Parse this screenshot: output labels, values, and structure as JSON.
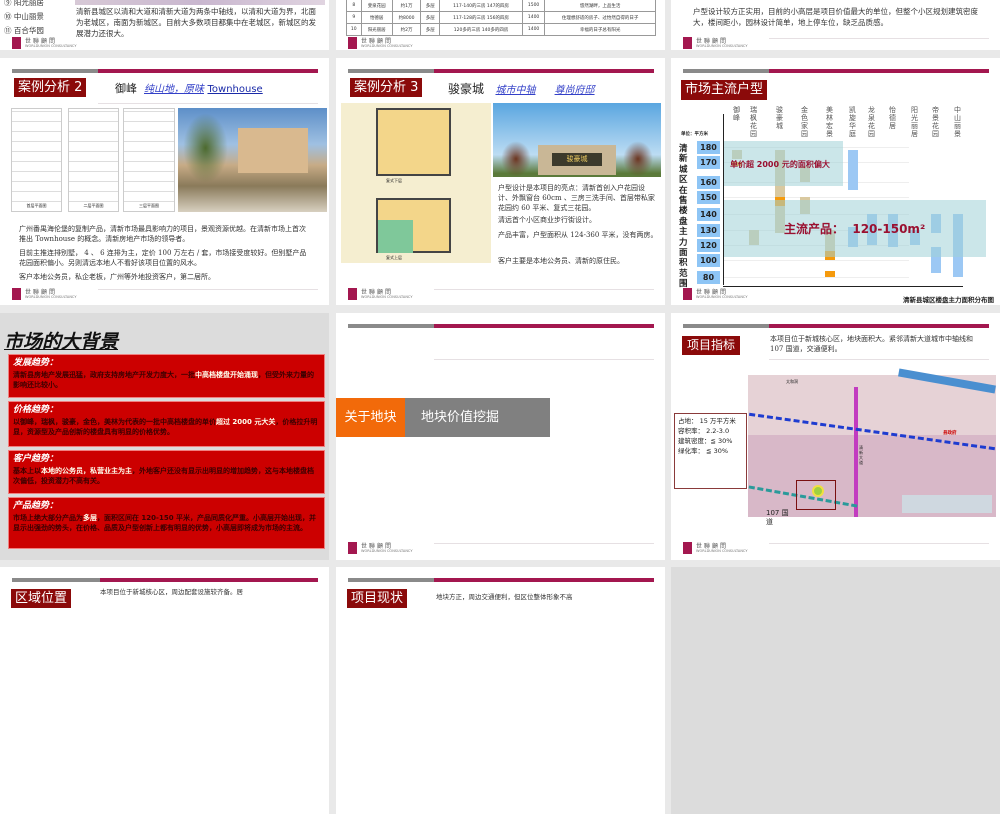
{
  "common": {
    "logo_cn": "世聯顧問",
    "logo_en": "WORLDUNION CONSULTANCY"
  },
  "r1s1": {
    "list": [
      "⑨ 阳光丽居",
      "⑩ 中山丽景",
      "⑪ 百合华园"
    ],
    "text": "清新县城区以清和大道和清新大道为两条中轴线，以清和大道为界，北面为老城区，南面为新城区。目前大多数项目都集中在老城区，新城区的发展潜力还很大。"
  },
  "r1s2": {
    "rows": [
      [
        "8",
        "斐泉花园",
        "约1万",
        "多层",
        "117-140的三房 147的四房",
        "1500",
        "悠然湖畔，上品生活"
      ],
      [
        "9",
        "怡德居",
        "约8000",
        "多层",
        "117-128的三房 156的四房",
        "1400",
        "住理想舒适的房子、过怡然自得的日子"
      ],
      [
        "10",
        "阳光丽居",
        "约2万",
        "多层",
        "120多的三房 140多的四房",
        "1400",
        "幸福的日子总有阳光"
      ]
    ]
  },
  "r1s3": {
    "text": "户型设计较方正实用，目前的小高层是项目价值最大的单位，但整个小区规划建筑密度大，楼间距小，园林设计简单，地上停车位，缺乏品质感。"
  },
  "case2": {
    "title": "案例分析 2",
    "name": "御峰",
    "tag1": "纯山地，原味",
    "tag2": "Townhouse",
    "plans": [
      "首层平面图",
      "二层平面图",
      "三层平面图"
    ],
    "paras": [
      "广州番禺海伦堡的复制产品，清新市场最具影响力的项目，景观资源优越。在清新市场上首次推出 Townhouse 的概念。清新房地产市场的领导者。",
      "目前主推连排别墅， 4 、 6 连排为主，定价 100 万左右 / 套，市场接受度较好。但别墅产品花园面积偏小。另则清远本地人不看好该项目位置的风水。",
      "客户本地公务员，私企老板，广州等外地投资客户，第二居所。"
    ]
  },
  "case3": {
    "title": "案例分析 3",
    "name": "骏豪城",
    "tag1": "城市中轴",
    "tag2": "尊尚府邸",
    "plan_top": "复式下层",
    "plan_bottom": "复式上层",
    "sign": "骏豪城",
    "paras": [
      "户型设计是本项目的亮点：清新首创入户花园设计、外飘窗台 60cm 、三房三洗手间、首层带私家花园约 60 平米、复式三花园。",
      "清远首个小区商业步行街设计。",
      "产品丰富，户型面积从 124-360 平米，没有两房。",
      "客户主要是本地公务员、清新的原住民。"
    ]
  },
  "chart_slide": {
    "title": "市场主流户型",
    "unit": "单位：平方米",
    "vlabel": "清新城区在售楼盘主力面积范围",
    "overlay1": "单价超 2000 元的面积偏大",
    "overlay2": "主流产品：  120-150m²",
    "caption": "清新县城区楼盘主力面积分布图"
  },
  "chart_data": {
    "type": "bar",
    "title": "清新县城区楼盘主力面积分布图",
    "ylabel": "清新城区在售楼盘主力面积范围",
    "unit": "平方米",
    "levels": [
      180,
      170,
      160,
      150,
      140,
      130,
      120,
      100,
      80
    ],
    "categories": [
      "御峰",
      "瑞枫花园",
      "骏豪城",
      "金色家园",
      "美林宏景",
      "凯旋华庭",
      "龙泉花园",
      "怡德居",
      "阳光丽居",
      "帝景花园",
      "中山丽景"
    ],
    "series": [
      {
        "name": "御峰",
        "segments": [
          [
            182,
            190,
            "orange"
          ],
          [
            172,
            182,
            "tan"
          ]
        ]
      },
      {
        "name": "瑞枫花园",
        "segments": [
          [
            120,
            130,
            "tan"
          ]
        ]
      },
      {
        "name": "骏豪城",
        "segments": [
          [
            178,
            182,
            "orange"
          ],
          [
            150,
            178,
            "tan"
          ],
          [
            145,
            150,
            "orange"
          ],
          [
            128,
            145,
            "tan"
          ]
        ]
      },
      {
        "name": "金色家园",
        "segments": [
          [
            160,
            168,
            "tan"
          ],
          [
            140,
            150,
            "tan"
          ]
        ]
      },
      {
        "name": "美林宏景",
        "segments": [
          [
            112,
            130,
            "tan"
          ],
          [
            100,
            112,
            "orange"
          ],
          [
            80,
            87,
            "orange"
          ]
        ]
      },
      {
        "name": "凯旋华庭",
        "segments": [
          [
            155,
            178,
            "blue"
          ],
          [
            117,
            132,
            "blue"
          ]
        ]
      },
      {
        "name": "龙泉花园",
        "segments": [
          [
            120,
            140,
            "blue"
          ]
        ]
      },
      {
        "name": "怡德居",
        "segments": [
          [
            117,
            140,
            "blue"
          ]
        ]
      },
      {
        "name": "阳光丽居",
        "segments": [
          [
            120,
            130,
            "blue"
          ]
        ]
      },
      {
        "name": "帝景花园",
        "segments": [
          [
            128,
            140,
            "blue"
          ],
          [
            85,
            118,
            "blue"
          ]
        ]
      },
      {
        "name": "中山丽景",
        "segments": [
          [
            80,
            140,
            "blue"
          ]
        ]
      }
    ],
    "colors": {
      "orange": "#f59a0c",
      "tan": "#d9c9a0",
      "blue": "#9cc8f4"
    }
  },
  "bg": {
    "title": "市场的大背景",
    "blocks": [
      {
        "h": "发展趋势：",
        "a": "清新县房地产发展迅猛，政府支持房地产开发力度大，一批",
        "w": "中高档楼盘开始涌现",
        "b": "，但受外来力量的影响还比较小。"
      },
      {
        "h": "价格趋势：",
        "a": "以御峰，瑞枫，骏豪，金色，美林为代表的一批中高档楼盘的单价",
        "w": "超过 2000 元大关",
        "b": "，价格拉升明显，资源型及产品创新的楼盘具有明显的价格优势。"
      },
      {
        "h": "客户趋势：",
        "a": "基本上以",
        "w": "本地的公务员，私营业主为主",
        "b": "，外地客户还没有显示出明显的增加趋势，这与本地楼盘档次偏低，投资潜力不高有关。"
      },
      {
        "h": "产品趋势：",
        "a": "市场上绝大部分产品为",
        "w": "多层",
        "b": "，面积区间在 120-150 平米，产品同质化严重。小高层开始出现，并显示出强劲的势头，在价格、品质及户型创新上都有明显的优势，小高层即将成为市场的主流。"
      }
    ]
  },
  "section": {
    "left": "关于地块",
    "right": "地块价值挖掘"
  },
  "index": {
    "title": "项目指标",
    "text": "本项目位于新城核心区，地块面积大。紧邻清新大道城市中轴线和 107 国道，交通便利。",
    "stats": [
      "占地： 15 万平方米",
      "容积率： 2.2-3.0",
      "建筑密度：≦ 30%",
      "绿化率： ≦ 30%"
    ],
    "road": "107 国道",
    "map_labels": [
      "太和洞",
      "县政府",
      "清新大道"
    ]
  },
  "r4s1": {
    "title": "区域位置",
    "text": "本项目位于新城核心区，周边配套设施较齐备。居"
  },
  "r4s2": {
    "title": "项目现状",
    "text": "地块方正，周边交通便利，但区位整体形象不高"
  }
}
